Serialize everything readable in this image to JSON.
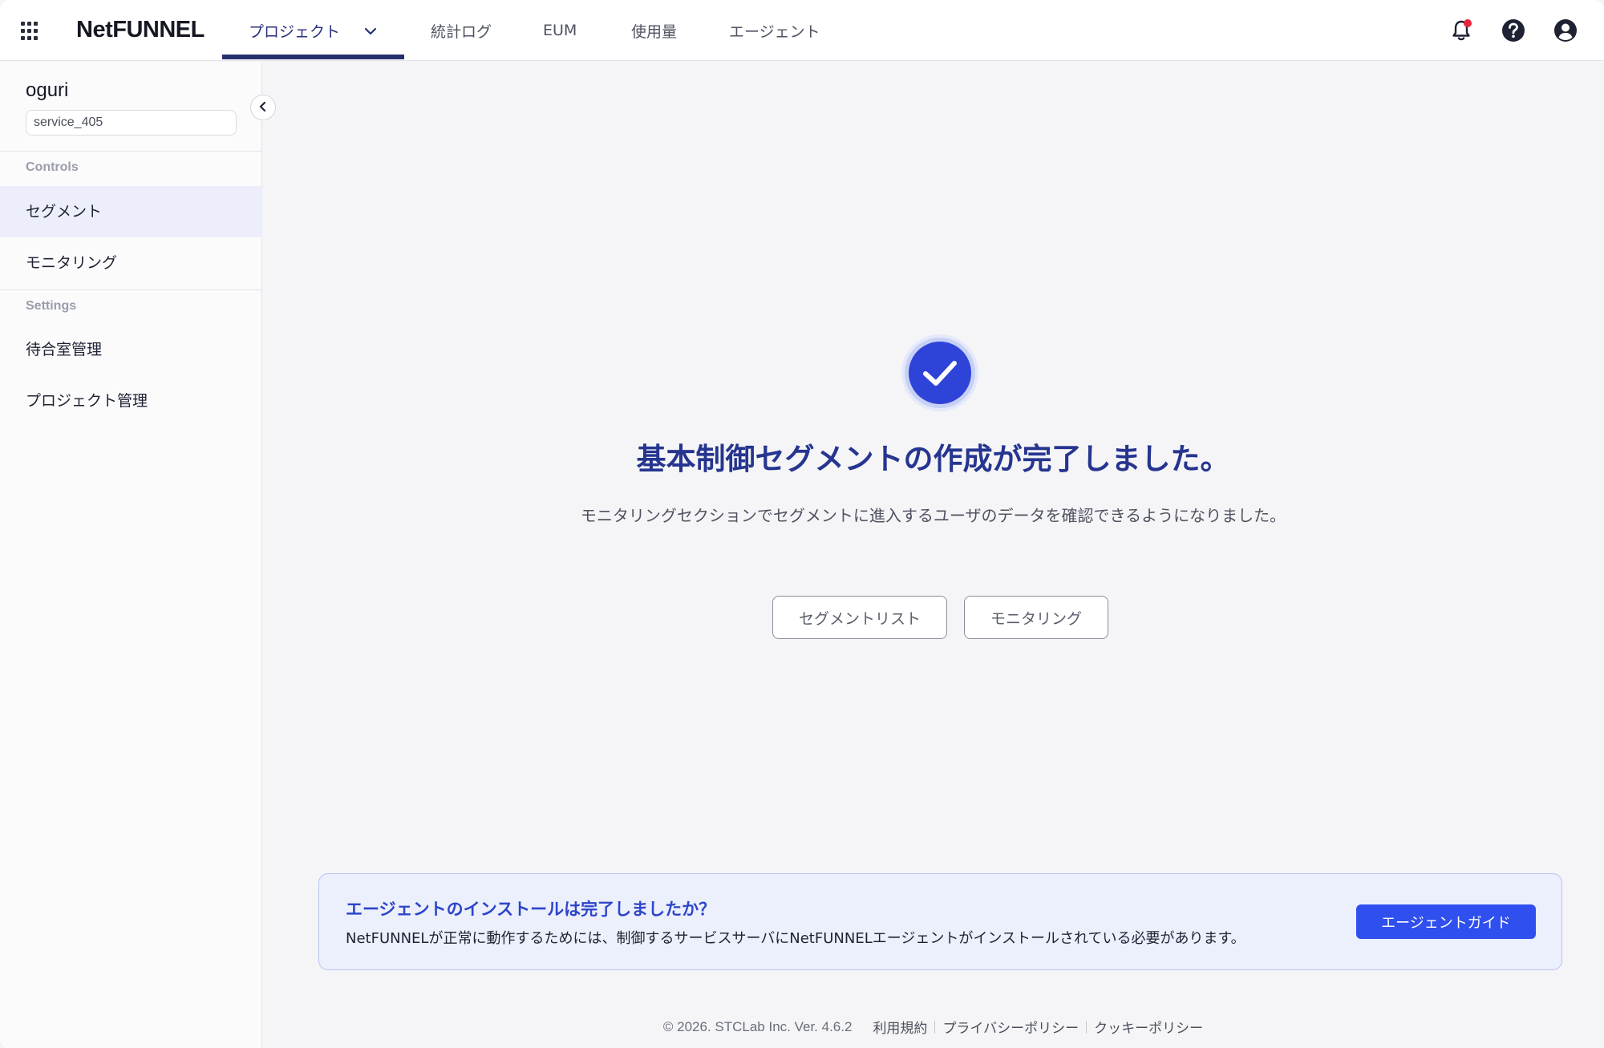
{
  "header": {
    "logo": "NetFUNNEL",
    "tabs": [
      {
        "label": "プロジェクト",
        "active": true
      },
      {
        "label": "統計ログ"
      },
      {
        "label": "EUM"
      },
      {
        "label": "使用量"
      },
      {
        "label": "エージェント"
      }
    ],
    "icons": [
      "apps-grid-icon",
      "bell-icon",
      "help-icon",
      "account-icon"
    ],
    "notification_dot_color": "#e6243a"
  },
  "sidebar": {
    "project_name": "oguri",
    "service_id": "service_405",
    "sections": [
      {
        "title": "Controls",
        "items": [
          {
            "label": "セグメント",
            "active": true
          },
          {
            "label": "モニタリング"
          }
        ]
      },
      {
        "title": "Settings",
        "items": [
          {
            "label": "待合室管理"
          },
          {
            "label": "プロジェクト管理"
          }
        ]
      }
    ]
  },
  "main": {
    "title": "基本制御セグメントの作成が完了しました。",
    "description": "モニタリングセクションでセグメントに進入するユーザのデータを確認できるようになりました。",
    "buttons": {
      "segment_list": "セグメントリスト",
      "monitoring": "モニタリング"
    }
  },
  "banner": {
    "title": "エージェントのインストールは完了しましたか？",
    "text": "NetFUNNELが正常に動作するためには、制御するサービスサーバにNetFUNNELエージェントがインストールされている必要があります。",
    "button": "エージェントガイド"
  },
  "footer": {
    "copyright": "© 2026. STCLab Inc.  Ver. 4.6.2",
    "links": [
      "利用規約",
      "プライバシーポリシー",
      "クッキーポリシー"
    ]
  },
  "colors": {
    "accent": "#2f4fee",
    "title": "#26358f",
    "nav_active": "#26306f"
  }
}
